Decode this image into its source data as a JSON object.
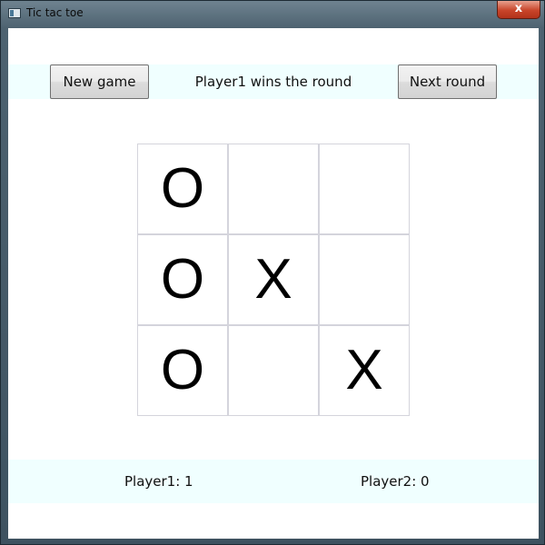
{
  "window": {
    "title": "Tic tac toe",
    "close_glyph": "x"
  },
  "toolbar": {
    "new_game_label": "New game",
    "status_text": "Player1 wins the round",
    "next_round_label": "Next round"
  },
  "board": {
    "cells": [
      "O",
      "",
      "",
      "O",
      "X",
      "",
      "O",
      "",
      "X"
    ]
  },
  "scores": {
    "player1": "Player1: 1",
    "player2": "Player2: 0"
  },
  "colors": {
    "band_background": "#f0ffff",
    "cell_border": "#d4d4dc"
  }
}
